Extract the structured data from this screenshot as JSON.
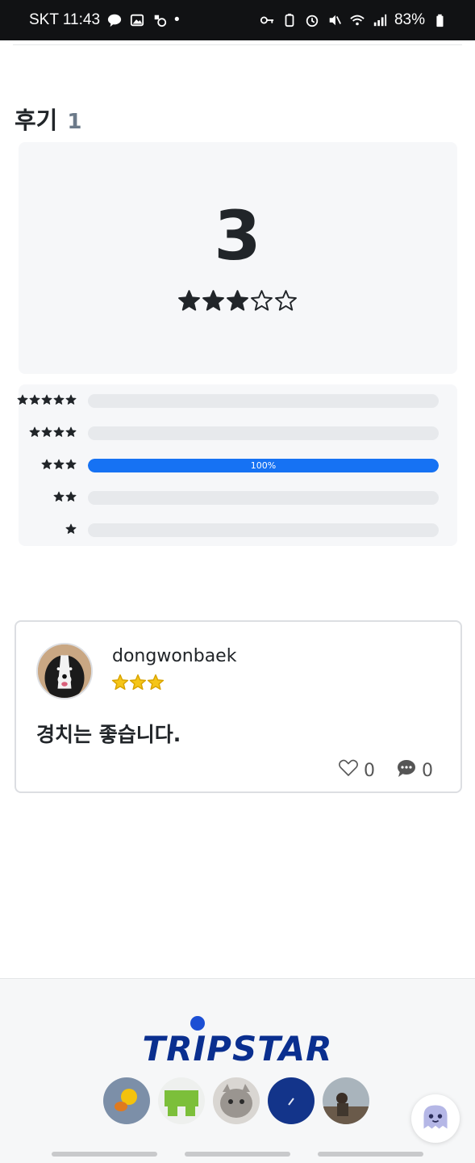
{
  "status_bar": {
    "carrier_time": "SKT 11:43",
    "dot": "•",
    "battery": "83%"
  },
  "reviews": {
    "title": "후기",
    "count": "1",
    "average": "3",
    "average_rating": 3,
    "max_rating": 5,
    "distribution": [
      {
        "stars": 5,
        "percent": 0,
        "label": ""
      },
      {
        "stars": 4,
        "percent": 0,
        "label": ""
      },
      {
        "stars": 3,
        "percent": 100,
        "label": "100%"
      },
      {
        "stars": 2,
        "percent": 0,
        "label": ""
      },
      {
        "stars": 1,
        "percent": 0,
        "label": ""
      }
    ],
    "accent_color": "#1672f3"
  },
  "review_card": {
    "username": "dongwonbaek",
    "rating": 3,
    "star_glyph_color": "#f5c518",
    "text": "경치는 좋습니다.",
    "likes": "0",
    "comments": "0"
  },
  "footer": {
    "logo": "TRIPSTAR",
    "brand_color": "#0a2f8f"
  }
}
